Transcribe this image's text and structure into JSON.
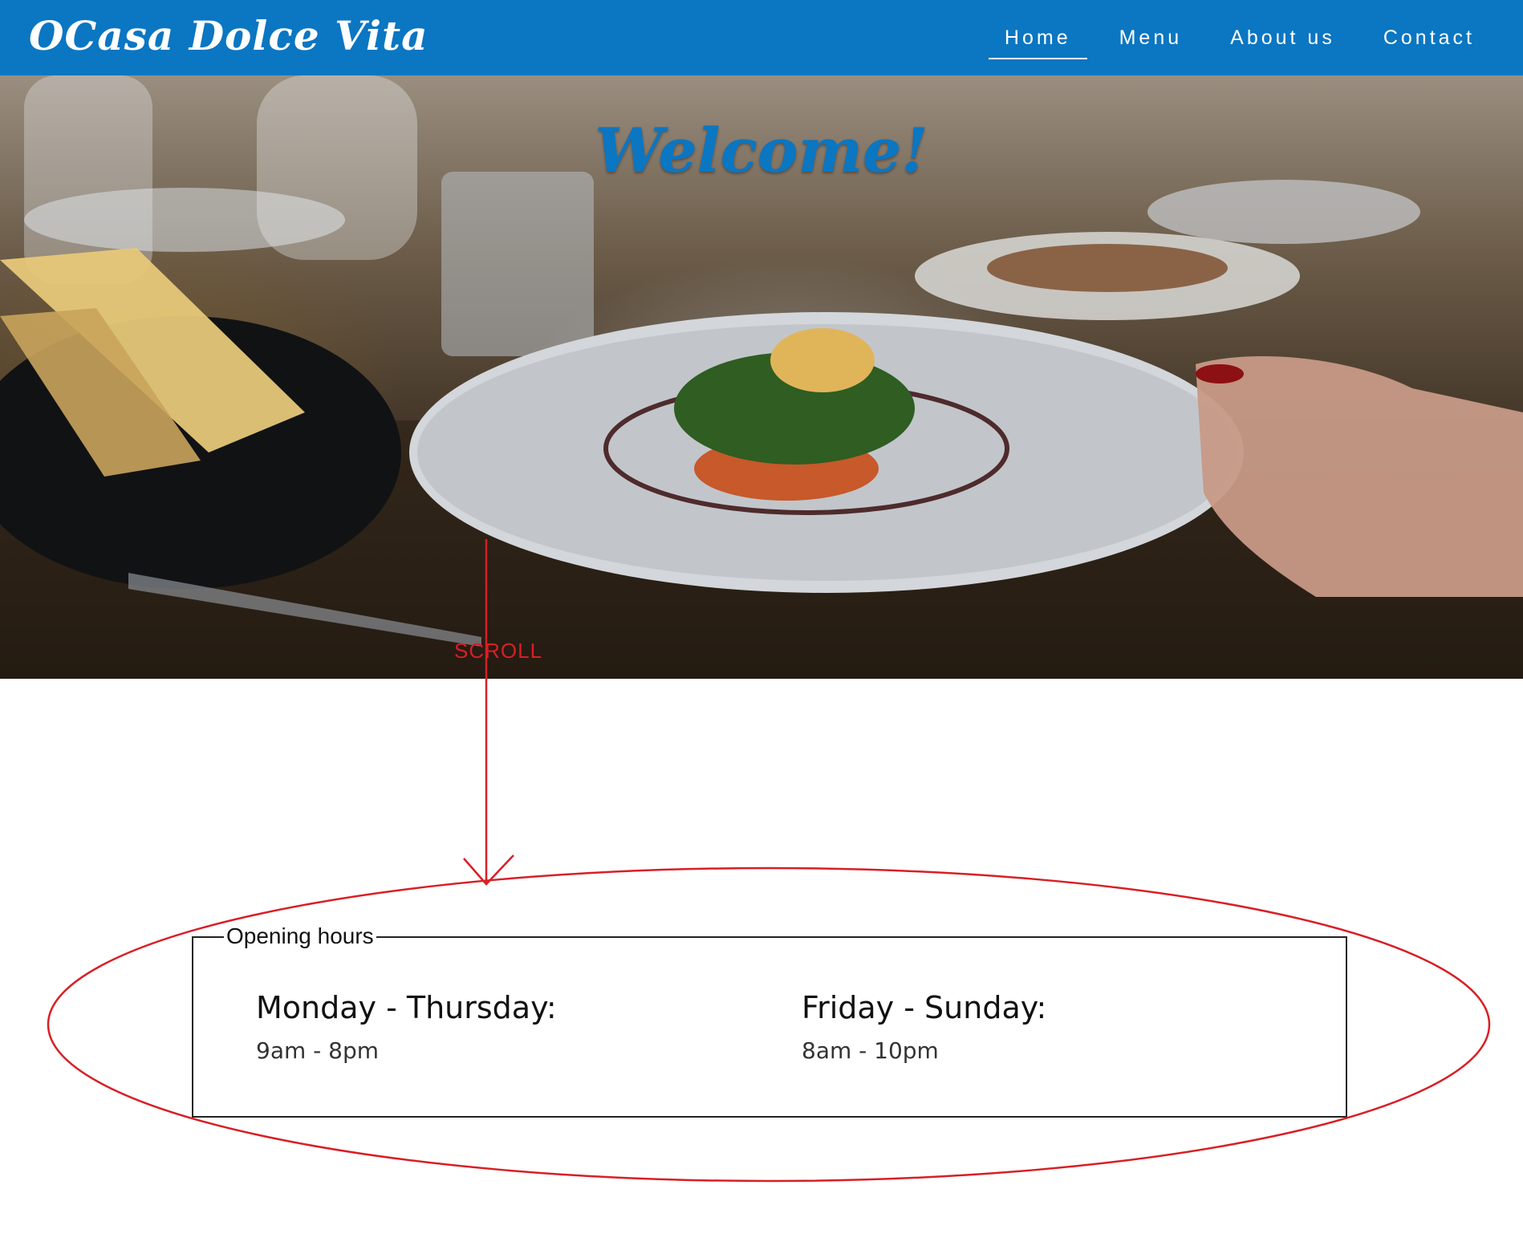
{
  "brand": {
    "title": "OCasa Dolce Vita"
  },
  "nav": {
    "items": [
      {
        "label": "Home",
        "active": true
      },
      {
        "label": "Menu",
        "active": false
      },
      {
        "label": "About us",
        "active": false
      },
      {
        "label": "Contact",
        "active": false
      }
    ]
  },
  "hero": {
    "heading": "Welcome!"
  },
  "annotation": {
    "label": "SCROLL",
    "color": "#d81f26"
  },
  "opening_hours": {
    "legend": "Opening hours",
    "groups": [
      {
        "days": "Monday - Thursday:",
        "hours": "9am - 8pm"
      },
      {
        "days": "Friday - Sunday:",
        "hours": "8am - 10pm"
      }
    ]
  },
  "colors": {
    "brand_blue": "#0b76c2",
    "annotation_red": "#d81f26",
    "text_dark": "#111111"
  }
}
